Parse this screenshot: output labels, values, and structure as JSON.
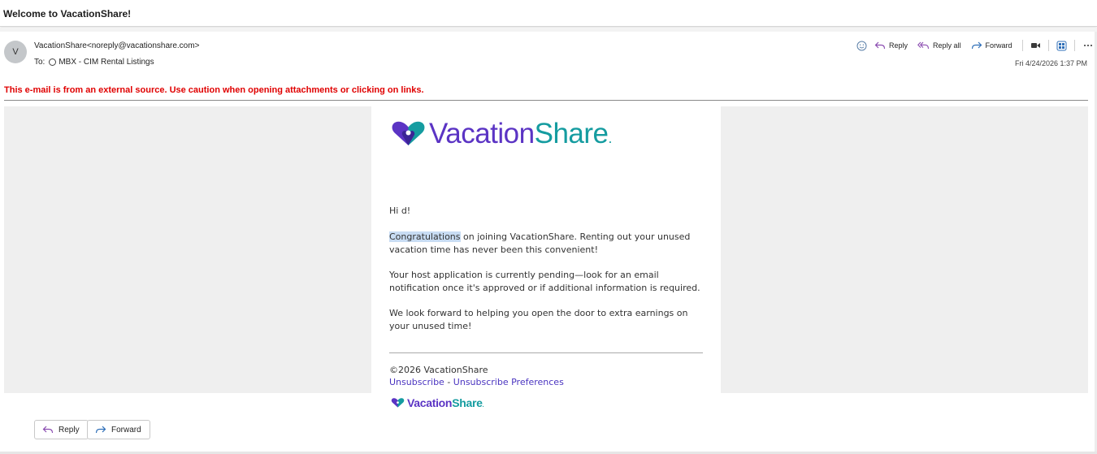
{
  "subject": "Welcome to VacationShare!",
  "sender": {
    "avatar_initial": "V",
    "from": "VacationShare<noreply@vacationshare.com>",
    "to_label": "To:",
    "to_value": "MBX - CIM Rental Listings"
  },
  "toolbar": {
    "reply_label": "Reply",
    "reply_all_label": "Reply all",
    "forward_label": "Forward",
    "date": "Fri 4/24/2026 1:37 PM"
  },
  "warning": "This e-mail is from an external source. Use caution when opening attachments or clicking on links.",
  "email": {
    "logo_word_1": "Vacation",
    "logo_word_2": "Share",
    "logo_mark": ".",
    "greeting": "Hi d!",
    "highlighted_word": "Congratulations",
    "paragraph_1_rest": " on joining VacationShare. Renting out your unused vacation time has never been this convenient!",
    "paragraph_2": "Your host application is currently pending—look for an email notification once it's approved or if additional information is required.",
    "paragraph_3": "We look forward to helping you open the door to extra earnings on your unused time!",
    "copyright": "©2026 VacationShare",
    "unsubscribe_label": "Unsubscribe",
    "link_separator": " - ",
    "unsubscribe_prefs_label": "Unsubscribe Preferences",
    "footer_logo_word_1": "Vacation",
    "footer_logo_word_2": "Share"
  },
  "bottom_actions": {
    "reply_label": "Reply",
    "forward_label": "Forward"
  },
  "colors": {
    "brand_purple": "#5b34c4",
    "brand_teal": "#159ca0",
    "warning_red": "#e00000",
    "link": "#4a34c0",
    "highlight": "#c8dcf3"
  },
  "icons": [
    "emoji-icon",
    "reply-icon",
    "reply-all-icon",
    "forward-icon",
    "teams-icon",
    "apps-icon",
    "more-icon",
    "heart-logo-icon"
  ]
}
